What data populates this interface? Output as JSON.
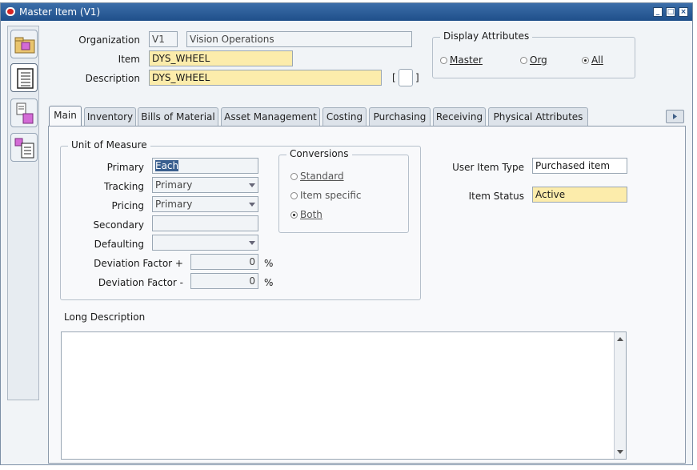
{
  "window": {
    "title": "Master Item (V1)"
  },
  "header": {
    "organization_label": "Organization",
    "organization_code": "V1",
    "organization_name": "Vision Operations",
    "item_label": "Item",
    "item_value": "DYS_WHEEL",
    "description_label": "Description",
    "description_value": "DYS_WHEEL",
    "descflex_left": "[",
    "descflex_right": "]"
  },
  "display_attributes": {
    "title": "Display Attributes",
    "options": [
      "Master",
      "Org",
      "All"
    ],
    "selected": "All"
  },
  "tabs": [
    "Main",
    "Inventory",
    "Bills of Material",
    "Asset Management",
    "Costing",
    "Purchasing",
    "Receiving",
    "Physical Attributes"
  ],
  "active_tab": "Main",
  "uom": {
    "title": "Unit of Measure",
    "primary_label": "Primary",
    "primary_value": "Each",
    "tracking_label": "Tracking",
    "tracking_value": "Primary",
    "pricing_label": "Pricing",
    "pricing_value": "Primary",
    "secondary_label": "Secondary",
    "secondary_value": "",
    "defaulting_label": "Defaulting",
    "defaulting_value": "",
    "dev_plus_label": "Deviation Factor +",
    "dev_plus_value": "0",
    "dev_minus_label": "Deviation Factor -",
    "dev_minus_value": "0",
    "percent": "%"
  },
  "conversions": {
    "title": "Conversions",
    "options": [
      "Standard",
      "Item specific",
      "Both"
    ],
    "selected": "Both"
  },
  "main": {
    "user_item_type_label": "User Item Type",
    "user_item_type_value": "Purchased item",
    "item_status_label": "Item Status",
    "item_status_value": "Active",
    "long_description_label": "Long Description",
    "long_description_value": ""
  },
  "colors": {
    "required_field": "#fcecab",
    "titlebar": "#2b5d98",
    "selected_text_highlight": "#3a5f8f"
  }
}
